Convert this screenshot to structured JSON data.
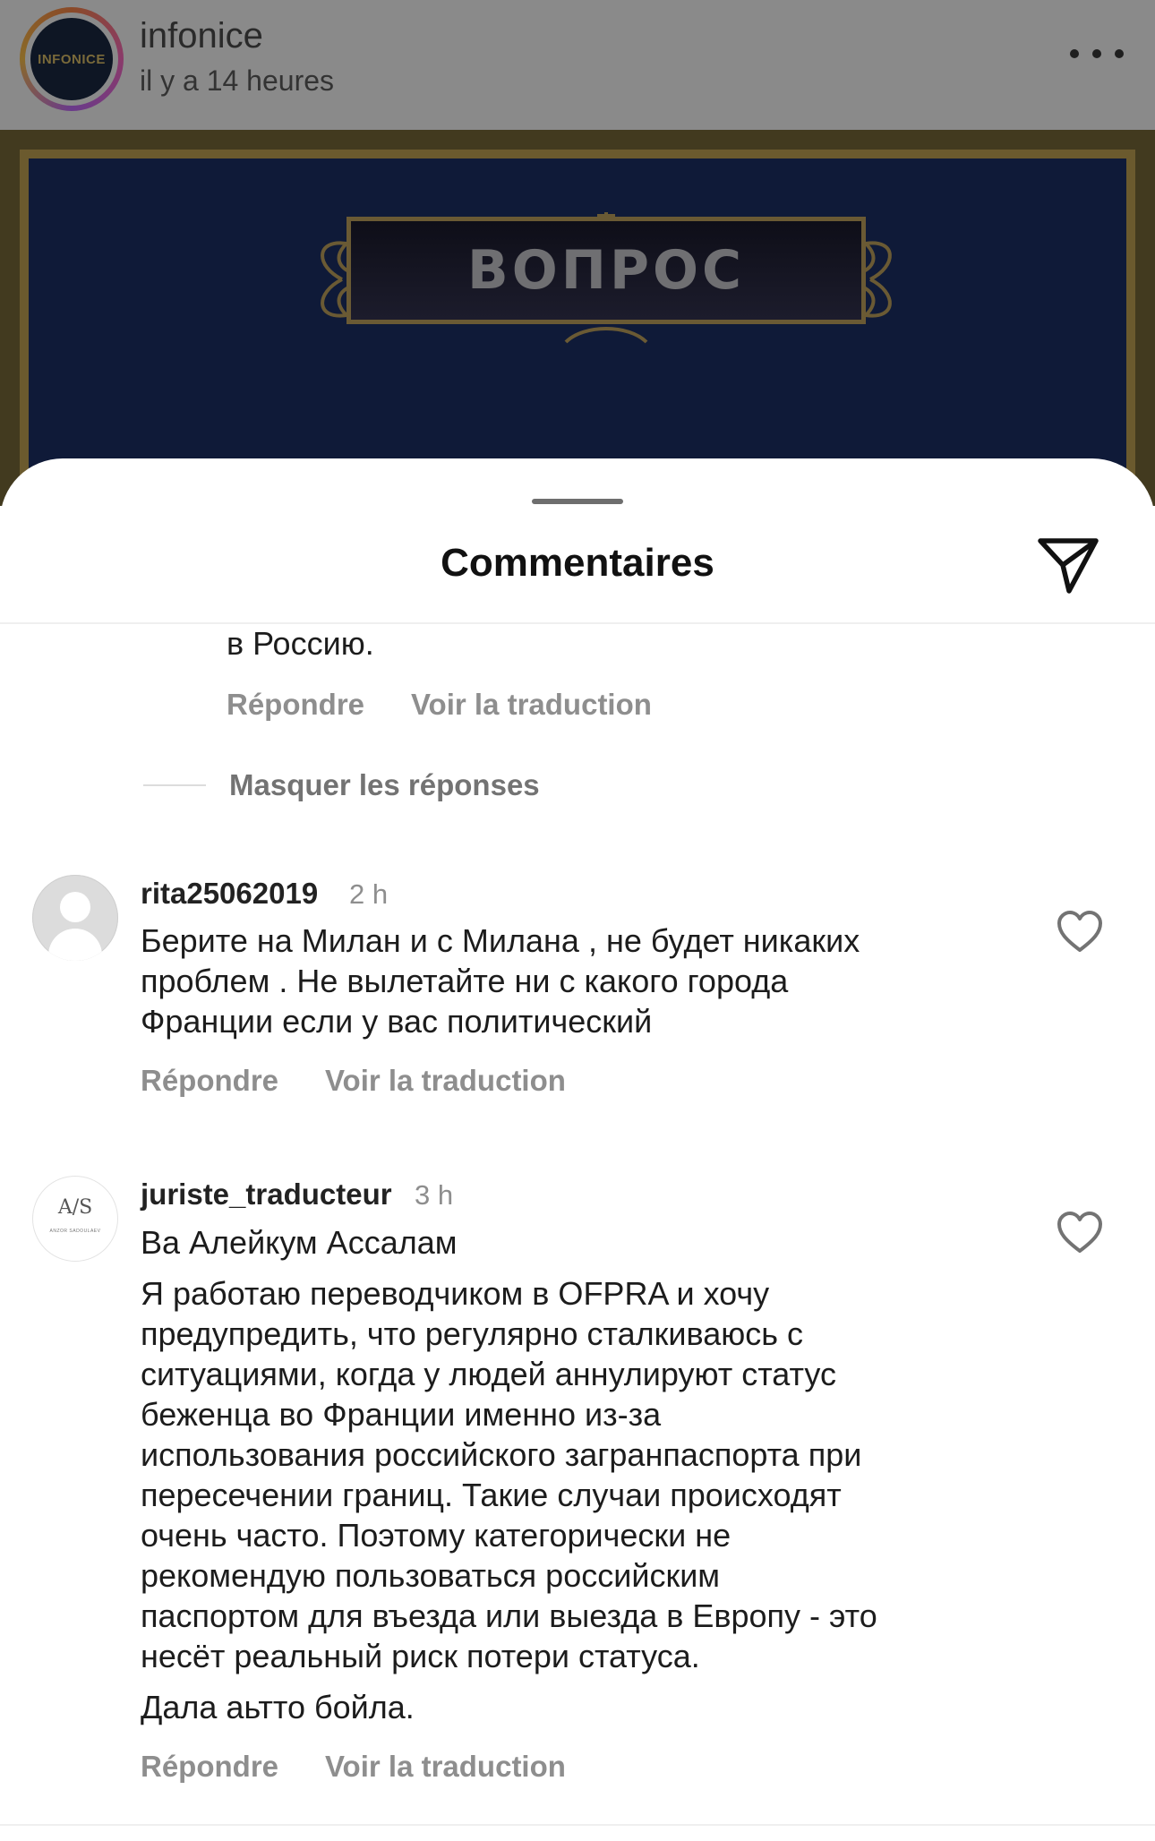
{
  "post": {
    "avatar_text": "INFONICE",
    "username": "infonice",
    "time": "il y a 14 heures",
    "image_title": "ВОПРОС"
  },
  "sheet": {
    "title": "Commentaires"
  },
  "partial_reply": {
    "text_tail": "в Россию.",
    "reply_label": "Répondre",
    "translate_label": "Voir la traduction"
  },
  "hide_replies_label": "Masquer les réponses",
  "comments": [
    {
      "username": "rita25062019",
      "time": "2 h",
      "lines": [
        "Берите на Милан  и с Милана , не будет никаких",
        "проблем . Не вылетайте ни с какого города",
        "Франции если у вас политический"
      ],
      "reply_label": "Répondre",
      "translate_label": "Voir la traduction"
    },
    {
      "username": "juriste_traducteur",
      "time": "3 h",
      "avatar_monogram": "A/S",
      "avatar_small_text": "ANZOR SADOULAEV",
      "lines": [
        "Ва Алейкум Ассалам",
        "Я работаю переводчиком в OFPRA и хочу",
        "предупредить, что регулярно сталкиваюсь с",
        "ситуациями, когда у людей аннулируют статус",
        "беженца во Франции именно из-за",
        "использования российского загранпаспорта при",
        "пересечении границ. Такие случаи происходят",
        "очень часто. Поэтому категорически не",
        "рекомендую пользоваться российским",
        "паспортом для въезда или выезда в Европу - это",
        "несёт реальный риск потери статуса.",
        "Дала аьтто бойла."
      ],
      "reply_label": "Répondre",
      "translate_label": "Voir la traduction"
    }
  ]
}
